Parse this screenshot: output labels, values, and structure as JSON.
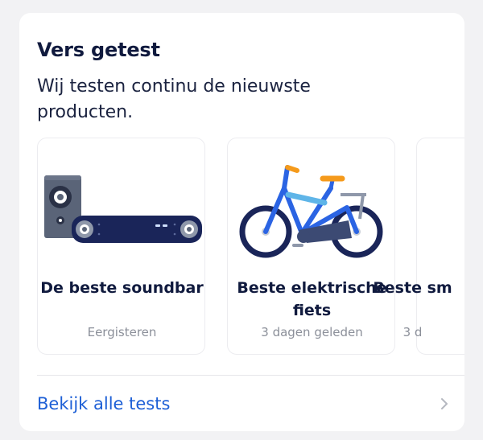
{
  "section": {
    "title": "Vers getest",
    "subtitle": "Wij testen continu de nieuwste producten."
  },
  "cards": [
    {
      "title": "De beste soundbar",
      "date": "Eergisteren",
      "icon": "soundbar-illustration"
    },
    {
      "title": "Beste elektrische fiets",
      "date": "3 dagen geleden",
      "icon": "ebike-illustration"
    },
    {
      "title": "Beste sm",
      "date": "3 d",
      "icon": ""
    }
  ],
  "footer": {
    "link_label": "Bekijk alle tests",
    "link_icon": "chevron-right-icon"
  },
  "colors": {
    "title": "#101a3e",
    "link": "#1d5fd6",
    "muted": "#8b8f99",
    "navy": "#1a2559",
    "blue": "#2b64e3",
    "orange": "#f59a1b"
  }
}
